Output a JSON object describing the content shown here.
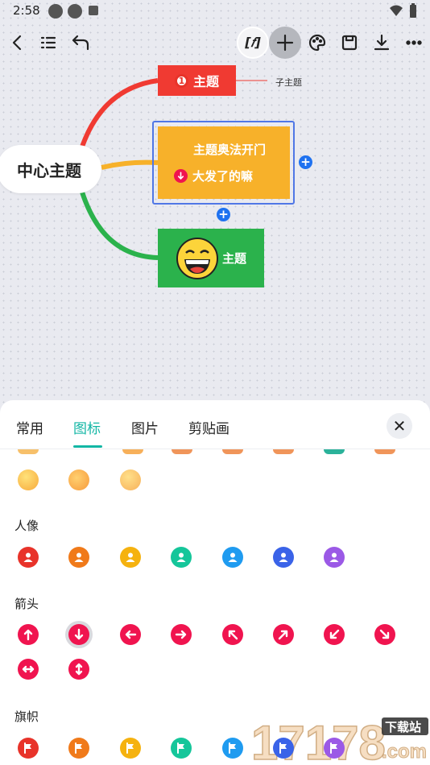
{
  "status_bar": {
    "time": "2:58"
  },
  "toolbar": {
    "formula_label": "[𝑓]"
  },
  "mindmap": {
    "center": "中心主题",
    "red_node": {
      "badge": "1",
      "label": "主题",
      "child": "子主题"
    },
    "yellow_node": {
      "line1": "主题奥法开门",
      "line2": "大发了的嘛"
    },
    "green_node": {
      "label": "主题"
    },
    "plus": "+"
  },
  "sheet": {
    "tabs": [
      "常用",
      "图标",
      "图片",
      "剪贴画"
    ],
    "active_tab": "图标",
    "close": "✕",
    "sections": {
      "people": "人像",
      "arrows": "箭头",
      "flags": "旗帜"
    },
    "people_colors": [
      "#e8332a",
      "#f07a1a",
      "#f5b20f",
      "#15c69a",
      "#1f9bf0",
      "#3a63e8",
      "#9b59e6"
    ],
    "arrow_color": "#f0144f",
    "flag_colors": [
      "#e8332a",
      "#f07a1a",
      "#f5b20f",
      "#15c69a",
      "#1f9bf0",
      "#3a63e8",
      "#9b59e6"
    ]
  },
  "watermark": {
    "brand": "17178",
    "tag": "下载站",
    "domain": ".com"
  }
}
